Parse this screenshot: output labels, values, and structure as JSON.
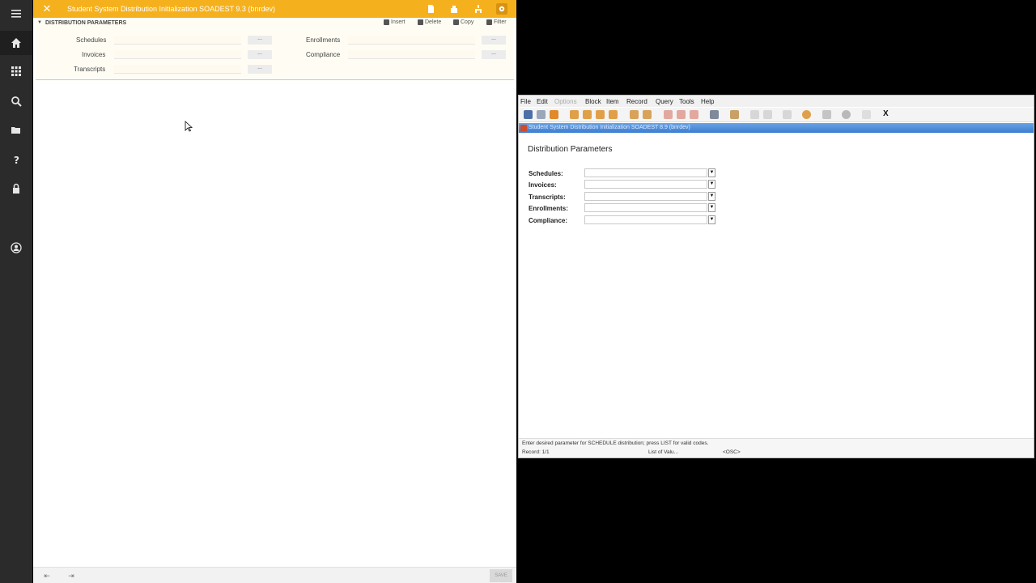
{
  "colors": {
    "banner_orange": "#f5b11d",
    "nav_dark": "#2b2b2b",
    "forms_title_blue": "#3b7dd1"
  },
  "nav": {
    "items": [
      {
        "icon": "menu-icon"
      },
      {
        "icon": "home-icon"
      },
      {
        "icon": "apps-grid-icon"
      },
      {
        "icon": "search-icon"
      },
      {
        "icon": "recent-folder-icon"
      },
      {
        "icon": "help-icon"
      },
      {
        "icon": "lock-icon"
      },
      {
        "icon": "user-icon"
      }
    ]
  },
  "banner9": {
    "title": "Student System Distribution Initialization SOADEST 9.3 (bnrdev)",
    "section_title": "DISTRIBUTION PARAMETERS",
    "toolbar": {
      "insert": "Insert",
      "delete": "Delete",
      "copy": "Copy",
      "filter": "Filter"
    },
    "fields": {
      "schedules": {
        "label": "Schedules",
        "value": ""
      },
      "invoices": {
        "label": "Invoices",
        "value": ""
      },
      "transcripts": {
        "label": "Transcripts",
        "value": ""
      },
      "enrollments": {
        "label": "Enrollments",
        "value": ""
      },
      "compliance": {
        "label": "Compliance",
        "value": ""
      }
    },
    "ellipsis": "...",
    "save_label": "SAVE"
  },
  "inb": {
    "menu": {
      "file": "File",
      "edit": "Edit",
      "options": "Options",
      "block": "Block",
      "item": "Item",
      "record": "Record",
      "query": "Query",
      "tools": "Tools",
      "help": "Help"
    },
    "close_label": "X",
    "window_title": "Student System Distribution Initialization  SOADEST  8.9  (bnrdev)",
    "heading": "Distribution Parameters",
    "params": {
      "schedules": "Schedules:",
      "invoices": "Invoices:",
      "transcripts": "Transcripts:",
      "enrollments": "Enrollments:",
      "compliance": "Compliance:"
    },
    "status_hint": "Enter desired parameter for SCHEDULE distribution; press LIST for valid codes.",
    "record_text": "Record: 1/1",
    "lov_text": "List of Valu...",
    "osc_text": "<OSC>"
  }
}
